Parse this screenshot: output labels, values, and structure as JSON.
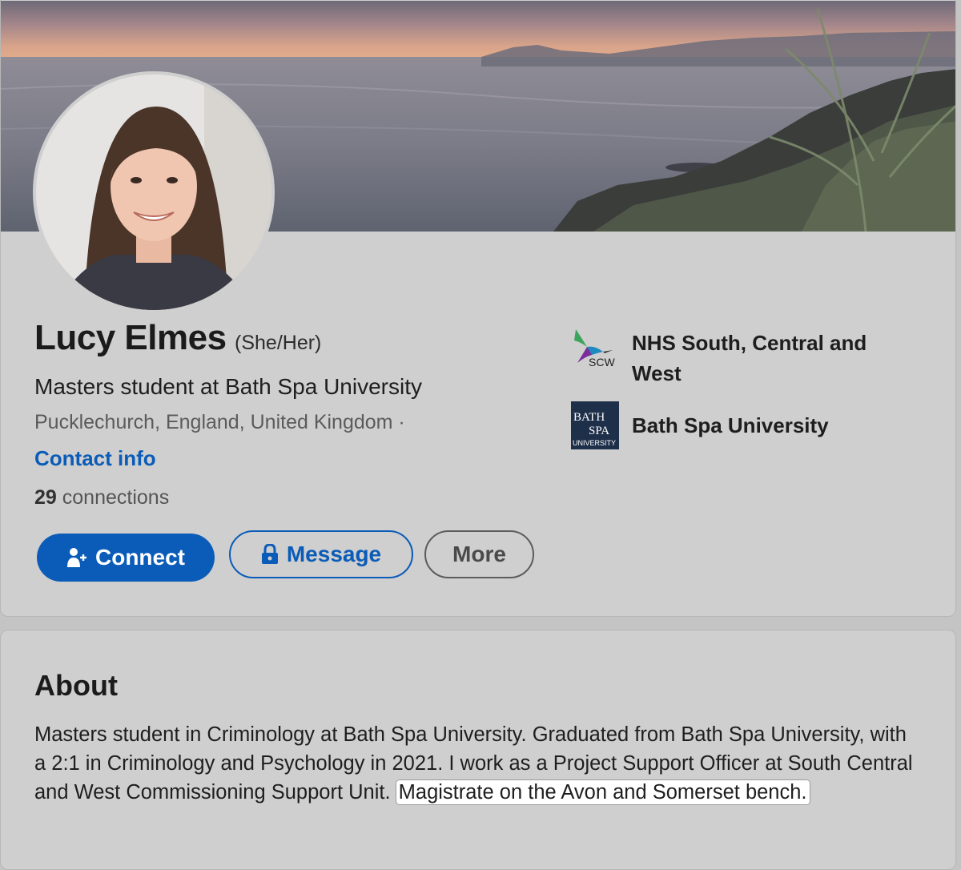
{
  "profile": {
    "name": "Lucy Elmes",
    "pronouns": "(She/Her)",
    "headline": "Masters student at Bath Spa University",
    "location": "Pucklechurch, England, United Kingdom ·",
    "contact_info": "Contact info",
    "connections_count": "29",
    "connections_label": "connections"
  },
  "actions": {
    "connect": "Connect",
    "message": "Message",
    "more": "More"
  },
  "organizations": [
    {
      "name": "NHS South, Central and West",
      "logo_text": "SCW",
      "logo_icon": "hummingbird-logo"
    },
    {
      "name": "Bath Spa University",
      "logo_text_1": "BATH",
      "logo_text_2": "SPA",
      "logo_text_3": "UNIVERSITY"
    }
  ],
  "about": {
    "title": "About",
    "text_main": "Masters student in Criminology at Bath Spa University. Graduated from Bath Spa University, with a 2:1 in Criminology and Psychology in 2021. I work as a Project Support Officer at South Central and West Commissioning Support Unit. ",
    "text_highlight": "Magistrate on the Avon and Somerset bench."
  },
  "colors": {
    "accent": "#0a5cb8",
    "background": "#c4c4c4",
    "card": "#cfcfcf",
    "highlight": "#ffffff"
  },
  "icons": {
    "connect": "add-person-icon",
    "message": "lock-icon"
  }
}
